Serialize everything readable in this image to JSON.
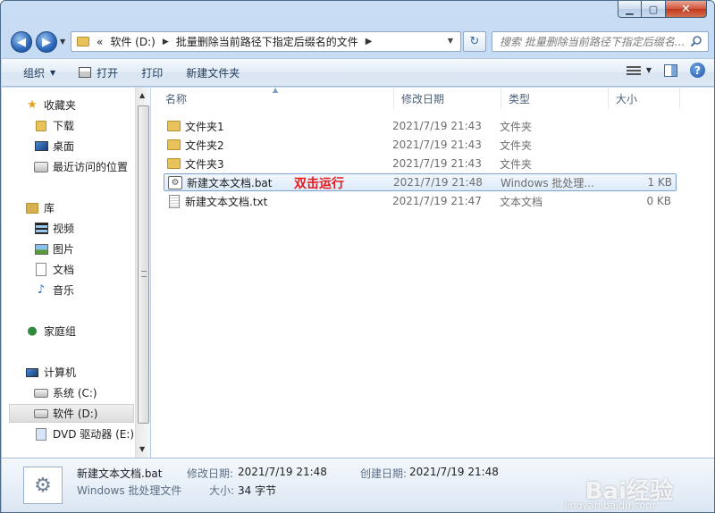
{
  "address": {
    "overflow": "«",
    "crumbs": [
      "软件 (D:)",
      "批量删除当前路径下指定后缀名的文件"
    ],
    "search_placeholder": "搜索 批量删除当前路径下指定后缀名..."
  },
  "toolbar": {
    "organize": "组织",
    "open": "打开",
    "print": "打印",
    "new_folder": "新建文件夹"
  },
  "nav": {
    "favorites": "收藏夹",
    "downloads": "下载",
    "desktop": "桌面",
    "recent": "最近访问的位置",
    "libraries": "库",
    "videos": "视频",
    "pictures": "图片",
    "documents": "文档",
    "music": "音乐",
    "homegroup": "家庭组",
    "computer": "计算机",
    "drive_c": "系统 (C:)",
    "drive_d": "软件 (D:)",
    "drive_e": "DVD 驱动器 (E:)"
  },
  "columns": {
    "name": "名称",
    "date": "修改日期",
    "type": "类型",
    "size": "大小"
  },
  "files": [
    {
      "name": "文件夹1",
      "date": "2021/7/19 21:43",
      "type": "文件夹",
      "size": ""
    },
    {
      "name": "文件夹2",
      "date": "2021/7/19 21:43",
      "type": "文件夹",
      "size": ""
    },
    {
      "name": "文件夹3",
      "date": "2021/7/19 21:43",
      "type": "文件夹",
      "size": ""
    },
    {
      "name": "新建文本文档.bat",
      "date": "2021/7/19 21:48",
      "type": "Windows 批处理...",
      "size": "1 KB"
    },
    {
      "name": "新建文本文档.txt",
      "date": "2021/7/19 21:47",
      "type": "文本文档",
      "size": "0 KB"
    }
  ],
  "annotation": "双击运行",
  "details": {
    "name": "新建文本文档.bat",
    "type": "Windows 批处理文件",
    "modified_label": "修改日期:",
    "modified": "2021/7/19 21:48",
    "created_label": "创建日期:",
    "created": "2021/7/19 21:48",
    "size_label": "大小:",
    "size": "34 字节"
  },
  "watermark": {
    "brand": "Bai经验",
    "url": "jingyan.baidu.com"
  }
}
